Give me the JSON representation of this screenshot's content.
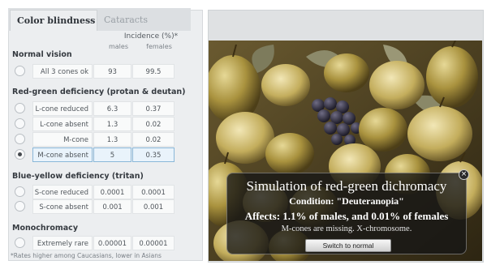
{
  "tabs": [
    {
      "label": "Color blindness",
      "active": true
    },
    {
      "label": "Cataracts",
      "active": false
    }
  ],
  "columns": {
    "incidence": "Incidence (%)*",
    "males": "males",
    "females": "females"
  },
  "sections": {
    "normal": "Normal vision",
    "redgreen": "Red-green deficiency (protan & deutan)",
    "blueyellow": "Blue-yellow deficiency (tritan)",
    "mono": "Monochromacy"
  },
  "rows": [
    {
      "label": "All 3 cones ok",
      "males": "93",
      "females": "99.5",
      "selected": false
    },
    {
      "label": "L-cone reduced",
      "males": "6.3",
      "females": "0.37",
      "selected": false
    },
    {
      "label": "L-cone absent",
      "males": "1.3",
      "females": "0.02",
      "selected": false
    },
    {
      "label": "M-cone reduced",
      "males": "1.3",
      "females": "0.02",
      "selected": false
    },
    {
      "label": "M-cone absent",
      "males": "5",
      "females": "0.35",
      "selected": true
    },
    {
      "label": "S-cone reduced",
      "males": "0.0001",
      "females": "0.0001",
      "selected": false
    },
    {
      "label": "S-cone absent",
      "males": "0.001",
      "females": "0.001",
      "selected": false
    },
    {
      "label": "Extremely rare",
      "males": "0.00001",
      "females": "0.00001",
      "selected": false
    }
  ],
  "footnote": "*Rates higher among Caucasians, lower in Asians",
  "overlay": {
    "title": "Simulation of red-green dichromacy",
    "condition": "Condition: \"Deuteranopia\"",
    "affects": "Affects: 1.1% of males, and 0.01% of females",
    "note": "M-cones are missing. X-chromosome.",
    "button": "Switch to normal",
    "close": "×"
  },
  "colors": {
    "selected_row_border": "#8ab7d8",
    "overlay_bg": "#161616"
  }
}
